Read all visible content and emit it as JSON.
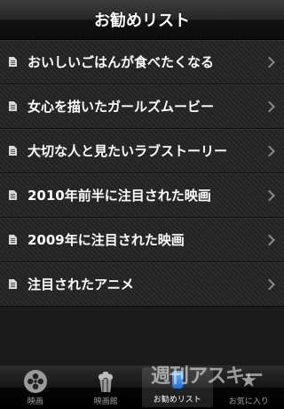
{
  "nav": {
    "title": "お勧めリスト"
  },
  "list": {
    "items": [
      {
        "label": "おいしいごはんが食べたくなる"
      },
      {
        "label": "女心を描いたガールズムービー"
      },
      {
        "label": "大切な人と見たいラブストーリー"
      },
      {
        "label": "2010年前半に注目された映画"
      },
      {
        "label": "2009年に注目された映画"
      },
      {
        "label": "注目されたアニメ"
      }
    ]
  },
  "tabbar": {
    "tabs": [
      {
        "label": "映画",
        "icon": "film-reel-icon",
        "selected": false
      },
      {
        "label": "映画館",
        "icon": "popcorn-icon",
        "selected": false
      },
      {
        "label": "お勧めリスト",
        "icon": "recommend-icon",
        "selected": true
      },
      {
        "label": "お気に入り",
        "icon": "star-icon",
        "selected": false
      }
    ]
  },
  "watermark": {
    "text": "週刊アスキー"
  },
  "colors": {
    "accent_selected": "#ffffff",
    "tab_inactive": "#a0a0a0"
  }
}
